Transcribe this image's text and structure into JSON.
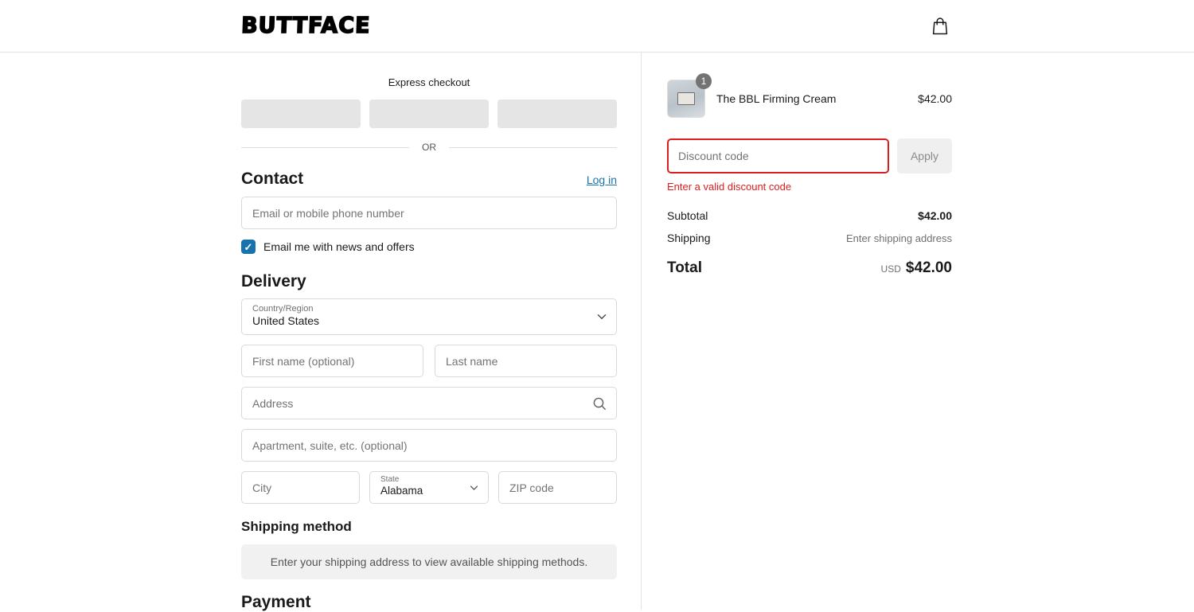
{
  "header": {
    "logo": "BUTTFACE"
  },
  "express": {
    "title": "Express checkout",
    "divider": "OR"
  },
  "contact": {
    "heading": "Contact",
    "login_link": "Log in",
    "email_placeholder": "Email or mobile phone number",
    "newsletter_label": "Email me with news and offers",
    "newsletter_checked": true,
    "checkmark": "✓"
  },
  "delivery": {
    "heading": "Delivery",
    "country_label": "Country/Region",
    "country_value": "United States",
    "first_name_placeholder": "First name (optional)",
    "last_name_placeholder": "Last name",
    "address_placeholder": "Address",
    "apartment_placeholder": "Apartment, suite, etc. (optional)",
    "city_placeholder": "City",
    "state_label": "State",
    "state_value": "Alabama",
    "zip_placeholder": "ZIP code"
  },
  "shipping_method": {
    "heading": "Shipping method",
    "notice": "Enter your shipping address to view available shipping methods."
  },
  "payment": {
    "heading": "Payment"
  },
  "summary": {
    "item": {
      "quantity": "1",
      "title": "The BBL Firming Cream",
      "price": "$42.00"
    },
    "discount": {
      "placeholder": "Discount code",
      "apply_label": "Apply",
      "error": "Enter a valid discount code"
    },
    "totals": {
      "subtotal_label": "Subtotal",
      "subtotal_value": "$42.00",
      "shipping_label": "Shipping",
      "shipping_value": "Enter shipping address",
      "total_label": "Total",
      "currency": "USD",
      "total_value": "$42.00"
    }
  },
  "colors": {
    "accent_blue": "#1773b0",
    "error_red": "#dd1d1d"
  }
}
